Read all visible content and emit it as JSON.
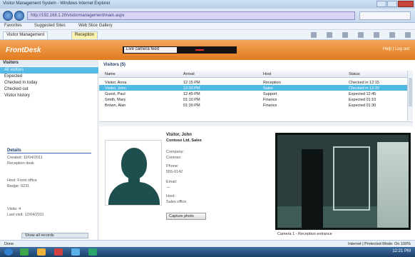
{
  "browser": {
    "title": "Visitor Management System - Windows Internet Explorer",
    "url": "http://192.168.1.20/visitormanagement/main.aspx",
    "favorites": [
      "Favorites",
      "Suggested Sites",
      "Web Slice Gallery"
    ],
    "tabs": [
      {
        "label": "Visitor Management",
        "active": false
      },
      {
        "label": "Reception",
        "active": true
      }
    ]
  },
  "app": {
    "logo": "FrontDesk",
    "video_label": "Live camera feed",
    "user_menu": "Help | Log out"
  },
  "sidebar": {
    "header": "Visitors",
    "items": [
      "All visitors",
      "Expected",
      "Checked in today",
      "Checked out",
      "Visitor history"
    ],
    "selected_index": 0,
    "detail_title": "Details",
    "details": [
      "Created: 12/04/2011",
      "Reception desk",
      "Host: Front office",
      "Badge: 0231",
      "Visits: 4",
      "Last visit: 12/04/2011"
    ],
    "footer_button": "Show all records"
  },
  "grid": {
    "toolbar": "Visitors (5)",
    "columns": [
      "Name",
      "Arrival",
      "Host",
      "Status"
    ],
    "rows": [
      [
        "Visitor, Anna",
        "12:15 PM",
        "Reception",
        "Checked in 12:15"
      ],
      [
        "Visitor, John",
        "12:20 PM",
        "Sales",
        "Checked in 12:20"
      ],
      [
        "Guest, Paul",
        "12:45 PM",
        "Support",
        "Expected 12:45"
      ],
      [
        "Smith, Mary",
        "01:10 PM",
        "Finance",
        "Expected 01:10"
      ],
      [
        "Brown, Alan",
        "01:30 PM",
        "Finance",
        "Expected 01:30"
      ]
    ],
    "selected_row": 1
  },
  "visitor": {
    "name": "Visitor, John",
    "company": "Contoso Ltd, Sales",
    "labels": [
      "Company:",
      "Phone:",
      "Email:",
      "Host:",
      "Badge:"
    ],
    "values": [
      "Contoso",
      "555-0142",
      "—",
      "Sales office",
      "0231"
    ],
    "button": "Capture photo"
  },
  "camera": {
    "caption": "Camera 1 - Reception entrance"
  },
  "status": {
    "left": "Done",
    "right": "Internet | Protected Mode: On   100%"
  },
  "taskbar": {
    "clock": "12:21 PM",
    "icon_colors": [
      "#2f7fd0",
      "#3da54a",
      "#f0b23a",
      "#d04040",
      "#5ab0e8",
      "#2aa36b"
    ]
  },
  "colors": {
    "accent": "#e27b1f",
    "selection": "#4fb8e3",
    "camera_bg": "#2b3d3c"
  }
}
